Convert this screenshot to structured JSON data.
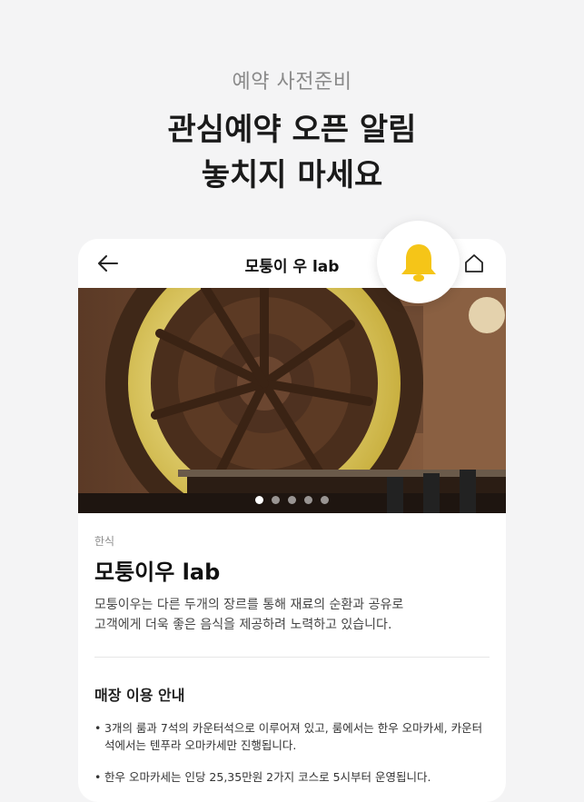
{
  "promo": {
    "subtitle": "예약 사전준비",
    "title_line1": "관심예약 오픈 알림",
    "title_line2": "놓치지 마세요"
  },
  "topbar": {
    "back_icon": "arrow-left-icon",
    "title": "모퉁이 우 lab",
    "home_icon": "home-icon"
  },
  "bell": {
    "icon": "bell-icon",
    "color": "#F5C518"
  },
  "carousel": {
    "total": 5,
    "active_index": 1
  },
  "store": {
    "category": "한식",
    "name": "모퉁이우 lab",
    "description_line1": "모퉁이우는 다른 두개의 장르를 통해 재료의 순환과 공유로",
    "description_line2": "고객에게 더욱 좋은 음식을 제공하려 노력하고 있습니다."
  },
  "guide": {
    "title": "매장 이용 안내",
    "items": [
      "3개의 룸과 7석의 카운터석으로 이루어져 있고, 룸에서는 한우 오마카세, 카운터석에서는 텐푸라 오마카세만 진행됩니다.",
      "한우 오마카세는 인당 25,35만원 2가지 코스로 5시부터 운영됩니다."
    ]
  }
}
